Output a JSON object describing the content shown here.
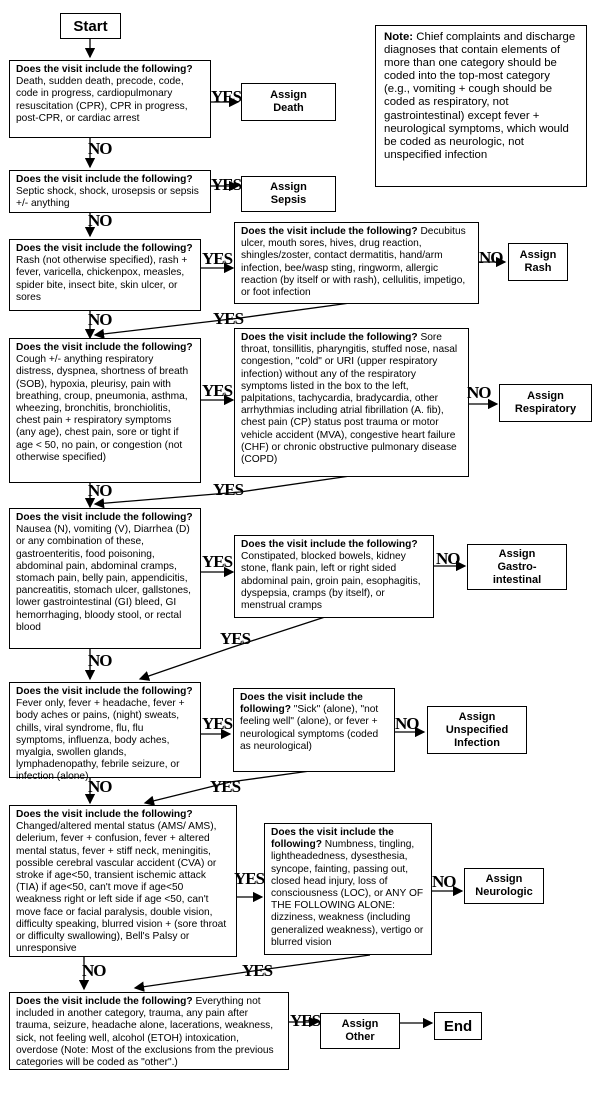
{
  "start_label": "Start",
  "end_label": "End",
  "yes_label": "YES",
  "no_label": "NO",
  "note": {
    "heading": "Note:",
    "text": " Chief complaints and discharge diagnoses that contain elements of more than one category should be coded into the top-most category (e.g., vomiting + cough should be coded as respiratory, not gastrointestinal) except fever + neurological symptoms, which would be coded as neurologic, not unspecified infection"
  },
  "question_lead": "Does the visit include the following?",
  "questions": {
    "death": " Death, sudden death, precode, code, code in progress, cardiopulmonary resuscitation (CPR), CPR in progress, post-CPR, or cardiac arrest",
    "sepsis": " Septic shock, shock, urosepsis or sepsis +/- anything",
    "rash": " Rash (not otherwise specified), rash + fever, varicella, chickenpox, measles, spider bite, insect bite, skin ulcer, or sores",
    "rash_exclusion": " Decubitus ulcer, mouth sores, hives, drug reaction, shingles/zoster, contact dermatitis, hand/arm infection, bee/wasp sting, ringworm, allergic reaction (by itself or with rash), cellulitis, impetigo, or foot infection",
    "respiratory": " Cough +/- anything respiratory distress, dyspnea, shortness of breath (SOB), hypoxia, pleurisy, pain with breathing, croup, pneumonia, asthma, wheezing, bronchitis, bronchiolitis, chest pain + respiratory symptoms (any age), chest pain, sore or tight if age < 50, no pain, or congestion (not otherwise specified)",
    "respiratory_exclusion": " Sore throat, tonsillitis, pharyngitis, stuffed nose, nasal congestion, \"cold\" or URI (upper respiratory infection) without any of the respiratory symptoms listed in the box to the left, palpitations, tachycardia, bradycardia, other arrhythmias including atrial fibrillation (A. fib), chest pain (CP) status post trauma or motor vehicle accident (MVA), congestive heart failure (CHF) or chronic obstructive pulmonary disease (COPD)",
    "gi": " Nausea (N), vomiting (V), Diarrhea (D) or any combination of these, gastroenteritis, food poisoning, abdominal pain, abdominal cramps, stomach pain, belly pain, appendicitis, pancreatitis, stomach ulcer, gallstones, lower gastrointestinal (GI) bleed, GI hemorrhaging, bloody stool, or rectal blood",
    "gi_exclusion": " Constipated, blocked bowels, kidney stone, flank pain, left or right sided abdominal pain, groin pain, esophagitis, dyspepsia, cramps (by itself), or menstrual cramps",
    "infection": " Fever only, fever + headache, fever + body aches or pains, (night) sweats, chills, viral syndrome, flu, flu symptoms, influenza, body aches, myalgia, swollen glands, lymphadenopathy, febrile seizure, or infection (alone)",
    "infection_exclusion": " \"Sick\" (alone), \"not feeling well\" (alone), or fever + neurological symptoms (coded as neurological)",
    "neuro": " Changed/altered mental status (AMS/ AMS), delerium, fever + confusion, fever + altered mental status, fever + stiff neck, meningitis, possible cerebral vascular accident (CVA) or stroke if age<50, transient ischemic attack (TIA) if age<50, can't move if age<50 weakness right or left side if age <50, can't move face or facial paralysis, double vision, difficulty speaking, blurred vision + (sore throat or difficulty swallowing), Bell's Palsy or unresponsive",
    "neuro_exclusion": " Numbness, tingling, lightheadedness, dysesthesia, syncope, fainting, passing out, closed head injury, loss of consciousness (LOC), or ANY OF THE FOLLOWING ALONE: dizziness, weakness (including generalized weakness), vertigo or blurred vision",
    "other": " Everything not included in another category, trauma, any pain after trauma, seizure, headache alone, lacerations, weakness, sick, not feeling well, alcohol (ETOH) intoxication, overdose (Note: Most of the exclusions from the previous categories will be coded as \"other\".)"
  },
  "assign": {
    "death": [
      "Assign",
      "Death"
    ],
    "sepsis": [
      "Assign",
      "Sepsis"
    ],
    "rash": [
      "Assign",
      "Rash"
    ],
    "respiratory": [
      "Assign",
      "Respiratory"
    ],
    "gi": [
      "Assign",
      "Gastro-",
      "intestinal"
    ],
    "infection": [
      "Assign",
      "Unspecified",
      "Infection"
    ],
    "neuro": [
      "Assign",
      "Neurologic"
    ],
    "other": [
      "Assign",
      "Other"
    ]
  }
}
